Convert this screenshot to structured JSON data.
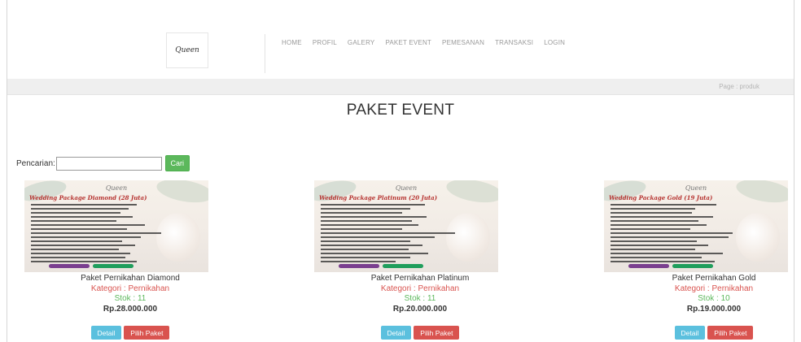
{
  "logo": {
    "text": "Queen"
  },
  "nav": {
    "items": [
      "HOME",
      "PROFIL",
      "GALERY",
      "PAKET EVENT",
      "PEMESANAN",
      "TRANSAKSI",
      "LOGIN"
    ]
  },
  "breadcrumb": {
    "text": "Page : produk"
  },
  "page": {
    "title": "PAKET EVENT"
  },
  "search": {
    "label": "Pencarian:",
    "value": "",
    "button": "Cari"
  },
  "products": [
    {
      "name": "Paket Pernikahan Diamond",
      "category": "Kategori : Pernikahan",
      "stock": "Stok : 11",
      "price": "Rp.28.000.000",
      "poster_title": "Wedding Package Diamond (28 Juta)",
      "detail_label": "Detail",
      "select_label": "Pilih Paket"
    },
    {
      "name": "Paket Pernikahan Platinum",
      "category": "Kategori : Pernikahan",
      "stock": "Stok : 11",
      "price": "Rp.20.000.000",
      "poster_title": "Wedding Package Platinum (20 Juta)",
      "detail_label": "Detail",
      "select_label": "Pilih Paket"
    },
    {
      "name": "Paket Pernikahan Gold",
      "category": "Kategori : Pernikahan",
      "stock": "Stok : 10",
      "price": "Rp.19.000.000",
      "poster_title": "Wedding Package Gold (19 Juta)",
      "detail_label": "Detail",
      "select_label": "Pilih Paket"
    }
  ],
  "colors": {
    "accent_green": "#5cb85c",
    "accent_red": "#d9534f",
    "accent_blue": "#5bc0de"
  }
}
